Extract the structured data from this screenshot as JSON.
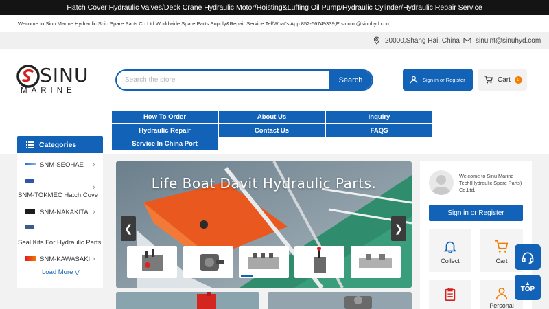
{
  "topbar": {
    "text": "Hatch Cover Hydraulic Valves/Deck Crane Hydraulic Motor/Hoisting&Luffing Oil Pump/Hydraulic Cylinder/Hydraulic Repair Service"
  },
  "welcome": {
    "text": "Wecome to Sinu Marine Hydraulic Ship Spare Parts Co.Ltd.Worldwide Spare Parts Supply&Repair Service.Tel/What's App:852-66749339,E:sinuint@sinuhyd.com"
  },
  "contact": {
    "address": "20000,Shang Hai, China",
    "email": "sinuint@sinuhyd.com"
  },
  "logo": {
    "brand": "SINU",
    "sub": "MARINE"
  },
  "search": {
    "placeholder": "Search the store",
    "button": "Search"
  },
  "account": {
    "signin": "Sign in or Register"
  },
  "cart": {
    "label": "Cart",
    "count": "0"
  },
  "nav": {
    "how_to_order": "How To Order",
    "about_us": "About Us",
    "inquiry": "Inquiry",
    "hydraulic_repair": "Hydraulic Repair",
    "contact_us": "Contact Us",
    "faqs": "FAQS",
    "service_china": "Service In China Port"
  },
  "categories": {
    "title": "Categories",
    "items": [
      "SNM-SEOHAE",
      "SNM-TOKMEC Hatch Cove",
      "SNM-NAKAKITA",
      "Seal Kits For Hydraulic Parts",
      "SNM-KAWASAKI"
    ],
    "load_more": "Load More"
  },
  "banner": {
    "title": "Life Boat Davit Hydraulic Parts.",
    "prev": "❮",
    "next": "❯"
  },
  "panel": {
    "welcome": "Welcome to Sinu Marine Tech(Hydraulic Spare Parts) Co.Ltd.",
    "signin": "Sign in or Register",
    "collect": "Collect",
    "cart": "Cart",
    "personal": "Personal"
  },
  "floating": {
    "top": "TOP"
  },
  "colors": {
    "primary": "#1263b7",
    "accent": "#f57c00",
    "topbar": "#141414"
  }
}
